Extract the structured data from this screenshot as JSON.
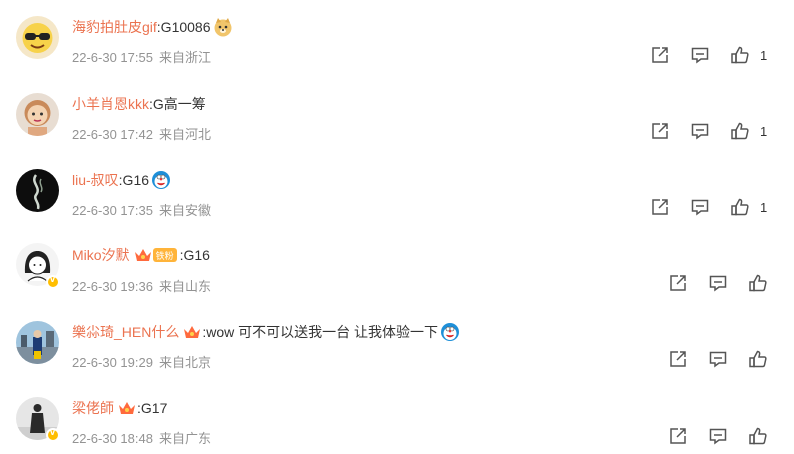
{
  "comments": [
    {
      "username": "海豹拍肚皮gif",
      "text": ":G10086",
      "time": "22-6-30 17:55",
      "location": "来自浙江",
      "likes": "1",
      "verified": false,
      "crown": false,
      "emoji": "doge-emoji"
    },
    {
      "username": "小羊肖恩kkk",
      "text": ":G高一筹",
      "time": "22-6-30 17:42",
      "location": "来自河北",
      "likes": "1",
      "verified": false,
      "crown": false,
      "emoji": ""
    },
    {
      "username": "liu-叔叹",
      "text": ":G16",
      "time": "22-6-30 17:35",
      "location": "来自安徽",
      "likes": "1",
      "verified": false,
      "crown": false,
      "emoji": "doraemon-emoji"
    },
    {
      "username": "Miko汐默",
      "fan_badge": "铁粉",
      "text": ":G16",
      "time": "22-6-30 19:36",
      "location": "来自山东",
      "likes": "",
      "verified": true,
      "crown": true,
      "emoji": ""
    },
    {
      "username": "樂尛琦_HEN什么",
      "text": ":wow 可不可以送我一台 让我体验一下",
      "time": "22-6-30 19:29",
      "location": "来自北京",
      "likes": "",
      "verified": false,
      "crown": true,
      "emoji": "doraemon-emoji"
    },
    {
      "username": "梁佬師",
      "text": ":G17",
      "time": "22-6-30 18:48",
      "location": "来自广东",
      "likes": "",
      "verified": true,
      "crown": true,
      "emoji": ""
    }
  ],
  "icons": {
    "share": "share-icon",
    "comment": "comment-icon",
    "like": "thumbs-up-icon"
  },
  "colors": {
    "username": "#eb7350",
    "meta": "#939393",
    "verified": "#ffbe00"
  }
}
